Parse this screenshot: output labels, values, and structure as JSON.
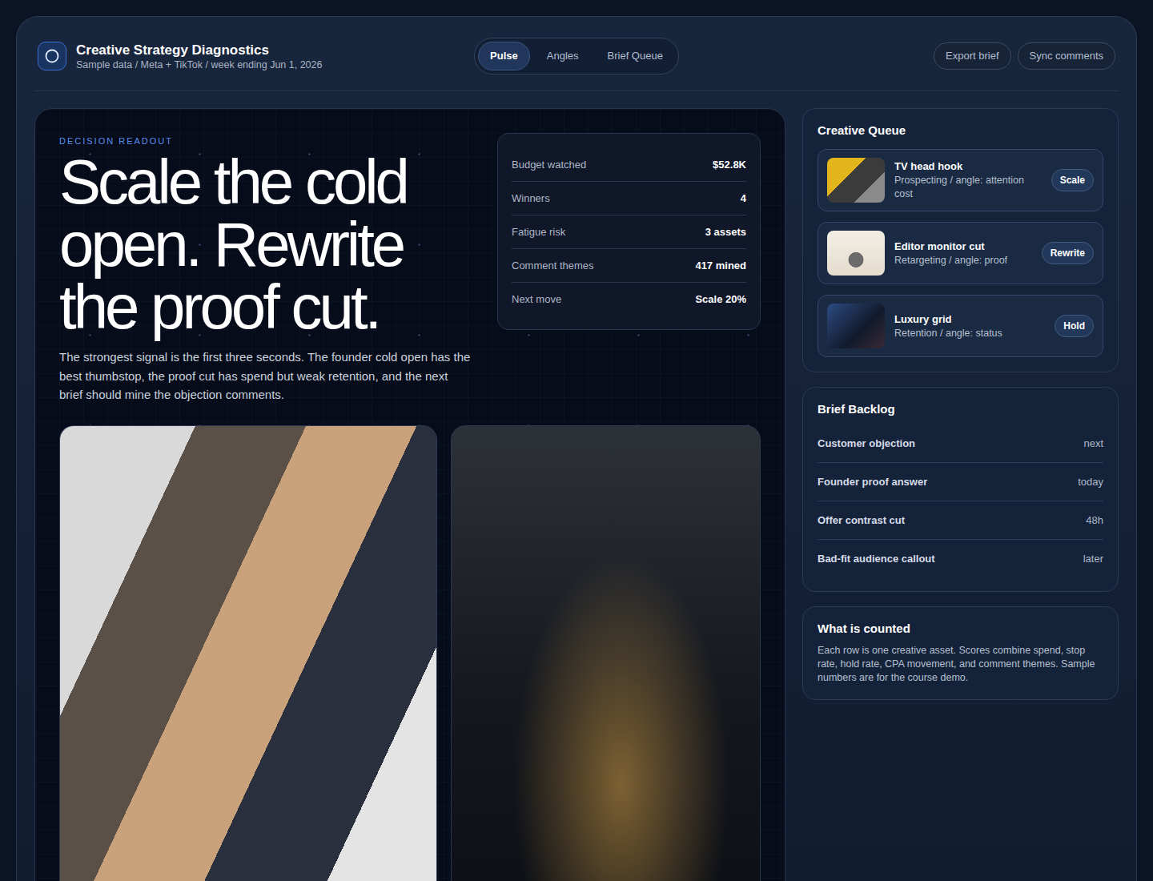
{
  "header": {
    "title": "Creative Strategy Diagnostics",
    "subtitle": "Sample data / Meta + TikTok / week ending Jun 1, 2026"
  },
  "tabs": [
    {
      "label": "Pulse",
      "selected": true
    },
    {
      "label": "Angles",
      "selected": false
    },
    {
      "label": "Brief Queue",
      "selected": false
    }
  ],
  "actions": [
    "Export brief",
    "Sync comments"
  ],
  "readout": {
    "eyebrow": "DECISION READOUT",
    "headline": "Scale the cold open. Rewrite the proof cut.",
    "summary": "The strongest signal is the first three seconds. The founder cold open has the best thumbstop, the proof cut has spend but weak retention, and the next brief should mine the objection comments."
  },
  "stats": [
    {
      "label": "Budget watched",
      "value": "$52.8K"
    },
    {
      "label": "Winners",
      "value": "4"
    },
    {
      "label": "Fatigue risk",
      "value": "3 assets"
    },
    {
      "label": "Comment themes",
      "value": "417 mined"
    },
    {
      "label": "Next move",
      "value": "Scale 20%"
    }
  ],
  "queue": {
    "title": "Creative Queue",
    "items": [
      {
        "title": "TV head hook",
        "meta": "Prospecting / angle: attention cost",
        "action": "Scale"
      },
      {
        "title": "Editor monitor cut",
        "meta": "Retargeting / angle: proof",
        "action": "Rewrite"
      },
      {
        "title": "Luxury grid",
        "meta": "Retention / angle: status",
        "action": "Hold"
      }
    ]
  },
  "backlog": {
    "title": "Brief Backlog",
    "items": [
      {
        "label": "Customer objection",
        "due": "next"
      },
      {
        "label": "Founder proof answer",
        "due": "today"
      },
      {
        "label": "Offer contrast cut",
        "due": "48h"
      },
      {
        "label": "Bad-fit audience callout",
        "due": "later"
      }
    ]
  },
  "counted": {
    "title": "What is counted",
    "text": "Each row is one creative asset. Scores combine spend, stop rate, hold rate, CPA movement, and comment themes. Sample numbers are for the course demo."
  }
}
